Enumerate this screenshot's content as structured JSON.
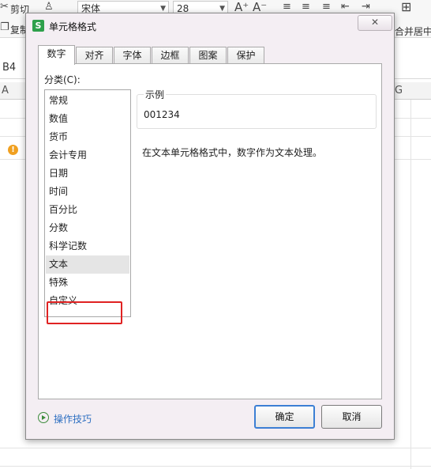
{
  "background": {
    "toolbar": {
      "cut_label": "剪切",
      "copy_label": "复制",
      "font_name": "宋体",
      "font_size": "28",
      "merge_label": "合并居中"
    },
    "name_box": "B4",
    "columns": [
      "A",
      "G"
    ],
    "warning_symbol": "!"
  },
  "dialog": {
    "title": "单元格格式",
    "logo_letter": "S",
    "close_symbol": "✕",
    "tabs": [
      {
        "label": "数字",
        "active": true
      },
      {
        "label": "对齐",
        "active": false
      },
      {
        "label": "字体",
        "active": false
      },
      {
        "label": "边框",
        "active": false
      },
      {
        "label": "图案",
        "active": false
      },
      {
        "label": "保护",
        "active": false
      }
    ],
    "category_label": "分类(C):",
    "categories": [
      "常规",
      "数值",
      "货币",
      "会计专用",
      "日期",
      "时间",
      "百分比",
      "分数",
      "科学记数",
      "文本",
      "特殊",
      "自定义"
    ],
    "selected_category": "文本",
    "sample": {
      "legend": "示例",
      "value": "001234"
    },
    "description": "在文本单元格格式中，数字作为文本处理。",
    "help_link": "操作技巧",
    "ok_button": "确定",
    "cancel_button": "取消",
    "highlight_color": "#e02222"
  }
}
